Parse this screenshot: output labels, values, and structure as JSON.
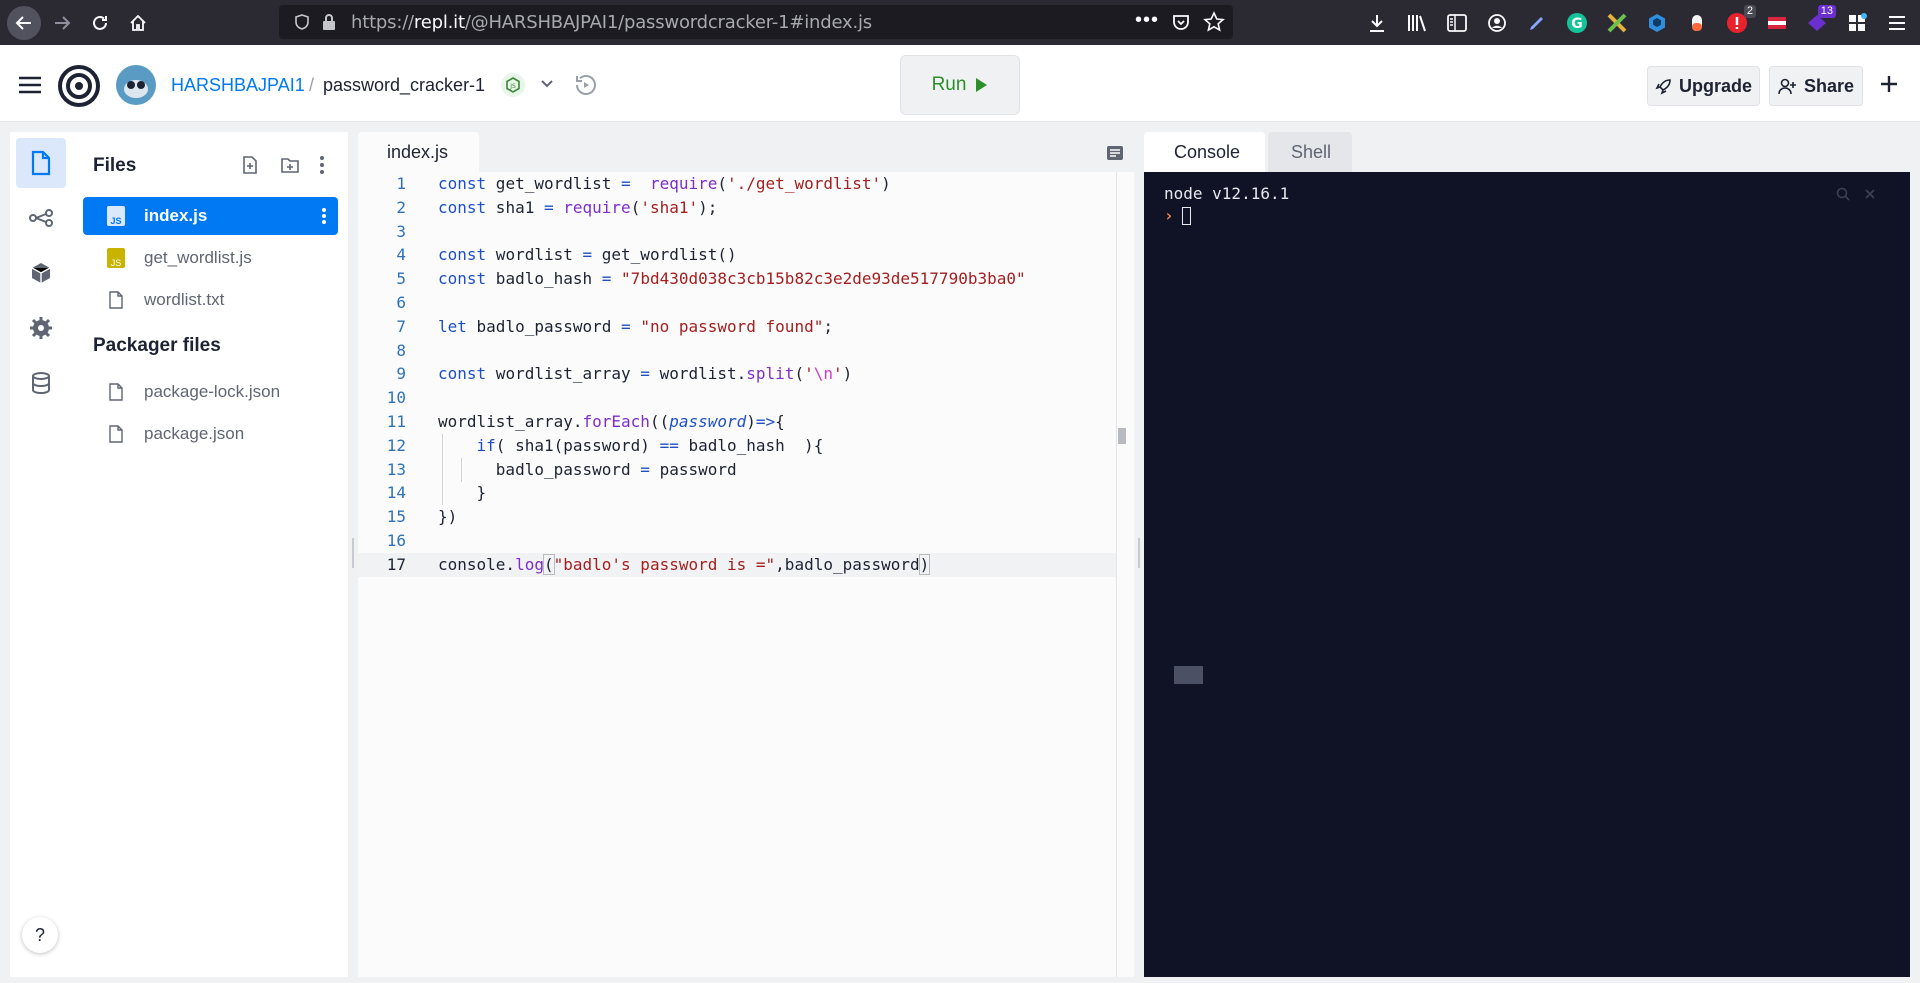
{
  "browser": {
    "url_prefix": "https://",
    "url_host": "repl.it",
    "url_path": "/@HARSHBAJPAI1/passwordcracker-1#index.js",
    "badges": [
      "2",
      "13"
    ]
  },
  "app": {
    "user": "HARSHBAJPAI1",
    "separator": "/",
    "repl_name": "password_cracker-1",
    "run_label": "Run",
    "upgrade_label": "Upgrade",
    "share_label": "Share",
    "help_label": "?"
  },
  "files": {
    "title": "Files",
    "items": [
      {
        "name": "index.js",
        "type": "js",
        "selected": true
      },
      {
        "name": "get_wordlist.js",
        "type": "js",
        "selected": false
      },
      {
        "name": "wordlist.txt",
        "type": "file",
        "selected": false
      }
    ],
    "packager_title": "Packager files",
    "packager_items": [
      {
        "name": "package-lock.json"
      },
      {
        "name": "package.json"
      }
    ]
  },
  "editor": {
    "tab_label": "index.js",
    "line_numbers": [
      "1",
      "2",
      "3",
      "4",
      "5",
      "6",
      "7",
      "8",
      "9",
      "10",
      "11",
      "12",
      "13",
      "14",
      "15",
      "16",
      "17"
    ],
    "active_line": 17
  },
  "console": {
    "tabs": [
      "Console",
      "Shell"
    ],
    "active_tab": "Console",
    "output": "node v12.16.1",
    "prompt": "›"
  },
  "colors": {
    "accent": "#0079f2",
    "run_green": "#2c8f2c",
    "terminal_bg": "#0f1325"
  }
}
